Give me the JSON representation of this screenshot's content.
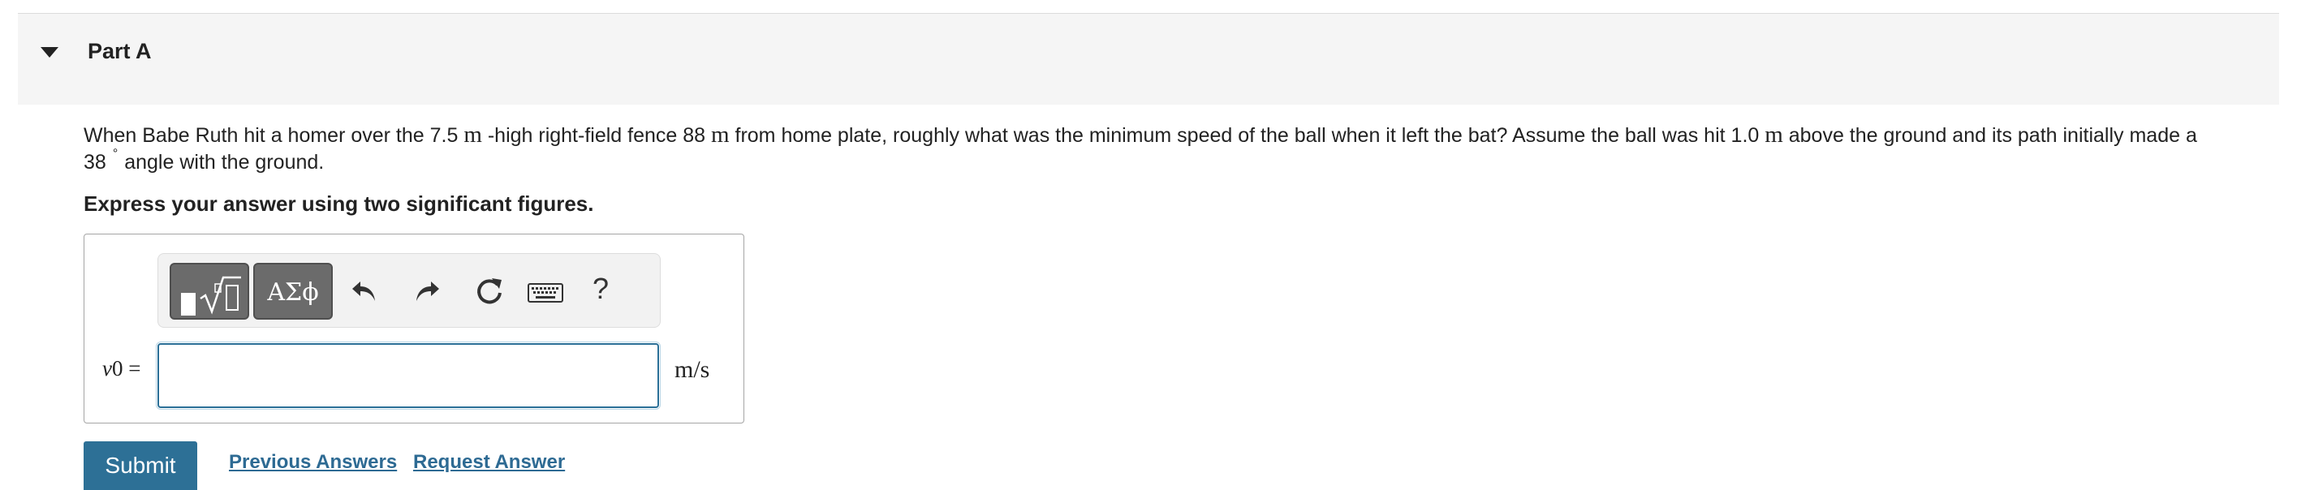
{
  "part": {
    "title": "Part A"
  },
  "question": {
    "text_1": "When Babe Ruth hit a homer over the 7.5 ",
    "unit_1": "m",
    "text_2": " -high right-field fence 88 ",
    "unit_2": "m",
    "text_3": " from home plate, roughly what was the minimum speed of the ball when it left the bat? Assume the ball was hit 1.0 ",
    "unit_3": "m",
    "text_4": " above the ground and its path initially made a 38",
    "degree_symbol": "°",
    "text_5": "angle with the ground."
  },
  "instruction": "Express your answer using two significant figures.",
  "toolbar": {
    "symbols_label": "ΑΣϕ",
    "help_label": "?"
  },
  "answer": {
    "variable": "v",
    "variable_subscript": "0",
    "equals": " =",
    "value": "",
    "unit": "m/s"
  },
  "actions": {
    "submit_label": "Submit",
    "previous_answers_label": "Previous Answers",
    "request_answer_label": "Request Answer"
  },
  "colors": {
    "accent": "#2d7096",
    "link": "#2d6a93",
    "header_bg": "#f5f5f5"
  }
}
